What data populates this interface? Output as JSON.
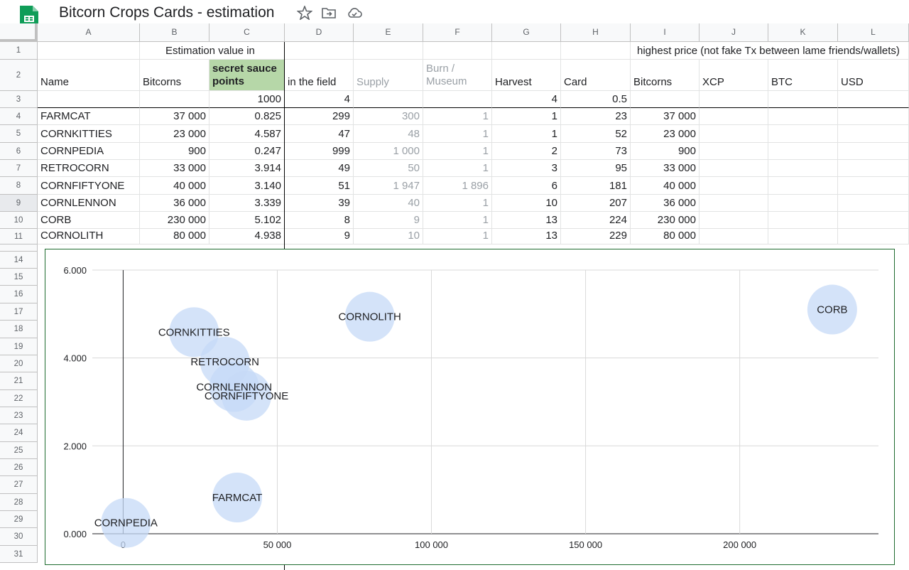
{
  "document": {
    "title": "Bitcorn Crops Cards - estimation",
    "app_icon": "sheets-icon",
    "toolbar_icons": [
      "star-icon",
      "move-to-folder-icon",
      "cloud-saved-icon"
    ]
  },
  "columns": [
    "A",
    "B",
    "C",
    "D",
    "E",
    "F",
    "G",
    "H",
    "I",
    "J",
    "K",
    "L"
  ],
  "rows_visible": [
    "1",
    "2",
    "3",
    "4",
    "5",
    "6",
    "7",
    "8",
    "9",
    "10",
    "11",
    "14",
    "15",
    "16",
    "17",
    "18",
    "19",
    "20",
    "21",
    "22",
    "23",
    "24",
    "25",
    "26",
    "27",
    "28",
    "29",
    "30",
    "31"
  ],
  "header": {
    "row1": {
      "b": "Estimation value in",
      "i": "highest price (not fake Tx between lame friends/wallets)"
    },
    "row2": {
      "a": "Name",
      "b": "Bitcorns",
      "c": "secret sauce points",
      "d": "in the field",
      "e": "Supply",
      "f": "Burn / Museum",
      "g": "Harvest",
      "h": "Card",
      "i": "Bitcorns",
      "j": "XCP",
      "k": "BTC",
      "l": "USD"
    },
    "row3": {
      "c": "1000",
      "d": "4",
      "g": "4",
      "h": "0.5"
    }
  },
  "table": [
    {
      "name": "FARMCAT",
      "bitcorns": "37 000",
      "points": "0.825",
      "field": "299",
      "supply": "300",
      "burn": "1",
      "harvest": "1",
      "card": "23",
      "high": "37 000"
    },
    {
      "name": "CORNKITTIES",
      "bitcorns": "23 000",
      "points": "4.587",
      "field": "47",
      "supply": "48",
      "burn": "1",
      "harvest": "1",
      "card": "52",
      "high": "23 000"
    },
    {
      "name": "CORNPEDIA",
      "bitcorns": "900",
      "points": "0.247",
      "field": "999",
      "supply": "1 000",
      "burn": "1",
      "harvest": "2",
      "card": "73",
      "high": "900"
    },
    {
      "name": "RETROCORN",
      "bitcorns": "33 000",
      "points": "3.914",
      "field": "49",
      "supply": "50",
      "burn": "1",
      "harvest": "3",
      "card": "95",
      "high": "33 000"
    },
    {
      "name": "CORNFIFTYONE",
      "bitcorns": "40 000",
      "points": "3.140",
      "field": "51",
      "supply": "1 947",
      "burn": "1 896",
      "harvest": "6",
      "card": "181",
      "high": "40 000"
    },
    {
      "name": "CORNLENNON",
      "bitcorns": "36 000",
      "points": "3.339",
      "field": "39",
      "supply": "40",
      "burn": "1",
      "harvest": "10",
      "card": "207",
      "high": "36 000"
    },
    {
      "name": "CORB",
      "bitcorns": "230 000",
      "points": "5.102",
      "field": "8",
      "supply": "9",
      "burn": "1",
      "harvest": "13",
      "card": "224",
      "high": "230 000"
    },
    {
      "name": "CORNOLITH",
      "bitcorns": "80 000",
      "points": "4.938",
      "field": "9",
      "supply": "10",
      "burn": "1",
      "harvest": "13",
      "card": "229",
      "high": "80 000"
    }
  ],
  "chart_data": {
    "type": "scatter",
    "title": "",
    "xlabel": "",
    "ylabel": "",
    "xlim": [
      -10000,
      245000
    ],
    "ylim": [
      0,
      6
    ],
    "x_ticks": [
      0,
      50000,
      100000,
      150000,
      200000
    ],
    "x_tick_labels": [
      "0",
      "50 000",
      "100 000",
      "150 000",
      "200 000"
    ],
    "y_ticks": [
      0,
      2,
      4,
      6
    ],
    "y_tick_labels": [
      "0.000",
      "2.000",
      "4.000",
      "6.000"
    ],
    "grid": true,
    "legend": "none",
    "bubble_color": "#c6d9f7",
    "points": [
      {
        "label": "FARMCAT",
        "x": 37000,
        "y": 0.825
      },
      {
        "label": "CORNKITTIES",
        "x": 23000,
        "y": 4.587
      },
      {
        "label": "CORNPEDIA",
        "x": 900,
        "y": 0.247
      },
      {
        "label": "RETROCORN",
        "x": 33000,
        "y": 3.914
      },
      {
        "label": "CORNFIFTYONE",
        "x": 40000,
        "y": 3.14
      },
      {
        "label": "CORNLENNON",
        "x": 36000,
        "y": 3.339
      },
      {
        "label": "CORB",
        "x": 230000,
        "y": 5.102
      },
      {
        "label": "CORNOLITH",
        "x": 80000,
        "y": 4.938
      }
    ]
  }
}
